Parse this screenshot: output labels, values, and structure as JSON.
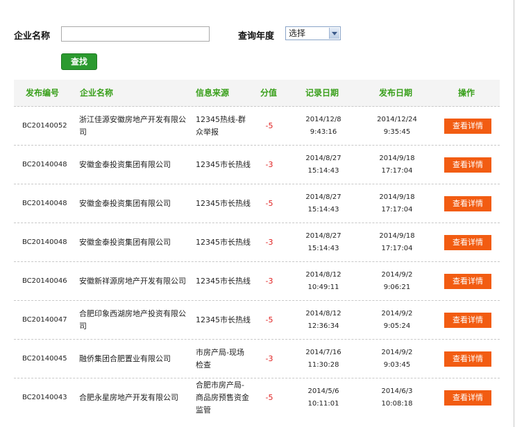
{
  "search": {
    "name_label": "企业名称",
    "name_value": "",
    "year_label": "查询年度",
    "year_selected": "选择",
    "find_button": "查找"
  },
  "table": {
    "headers": {
      "code": "发布编号",
      "name": "企业名称",
      "source": "信息来源",
      "score": "分值",
      "record_date": "记录日期",
      "publish_date": "发布日期",
      "operation": "操作"
    },
    "rows": [
      {
        "code": "BC20140052",
        "name": "浙江佳源安徽房地产开发有限公司",
        "source": "12345热线-群众举报",
        "score": "-5",
        "record_date": "2014/12/8",
        "record_time": "9:43:16",
        "publish_date": "2014/12/24",
        "publish_time": "9:35:45",
        "action": "查看详情"
      },
      {
        "code": "BC20140048",
        "name": "安徽金泰投资集团有限公司",
        "source": "12345市长热线",
        "score": "-3",
        "record_date": "2014/8/27",
        "record_time": "15:14:43",
        "publish_date": "2014/9/18",
        "publish_time": "17:17:04",
        "action": "查看详情"
      },
      {
        "code": "BC20140048",
        "name": "安徽金泰投资集团有限公司",
        "source": "12345市长热线",
        "score": "-5",
        "record_date": "2014/8/27",
        "record_time": "15:14:43",
        "publish_date": "2014/9/18",
        "publish_time": "17:17:04",
        "action": "查看详情"
      },
      {
        "code": "BC20140048",
        "name": "安徽金泰投资集团有限公司",
        "source": "12345市长热线",
        "score": "-3",
        "record_date": "2014/8/27",
        "record_time": "15:14:43",
        "publish_date": "2014/9/18",
        "publish_time": "17:17:04",
        "action": "查看详情"
      },
      {
        "code": "BC20140046",
        "name": "安徽新祥源房地产开发有限公司",
        "source": "12345市长热线",
        "score": "-3",
        "record_date": "2014/8/12",
        "record_time": "10:49:11",
        "publish_date": "2014/9/2",
        "publish_time": "9:06:21",
        "action": "查看详情"
      },
      {
        "code": "BC20140047",
        "name": "合肥印象西湖房地产投资有限公司",
        "source": "12345市长热线",
        "score": "-5",
        "record_date": "2014/8/12",
        "record_time": "12:36:34",
        "publish_date": "2014/9/2",
        "publish_time": "9:05:24",
        "action": "查看详情"
      },
      {
        "code": "BC20140045",
        "name": "融侨集团合肥置业有限公司",
        "source": "市房产局-现场检查",
        "score": "-3",
        "record_date": "2014/7/16",
        "record_time": "11:30:28",
        "publish_date": "2014/9/2",
        "publish_time": "9:03:45",
        "action": "查看详情"
      },
      {
        "code": "BC20140043",
        "name": "合肥永星房地产开发有限公司",
        "source": "合肥市房产局-商品房预售资金监管",
        "score": "-5",
        "record_date": "2014/5/6",
        "record_time": "10:11:01",
        "publish_date": "2014/6/3",
        "publish_time": "10:08:18",
        "action": "查看详情"
      }
    ]
  },
  "colors": {
    "header_text": "#3aa01c",
    "find_button": "#2b9a2f",
    "detail_button": "#f25c12",
    "score": "#e02020"
  }
}
